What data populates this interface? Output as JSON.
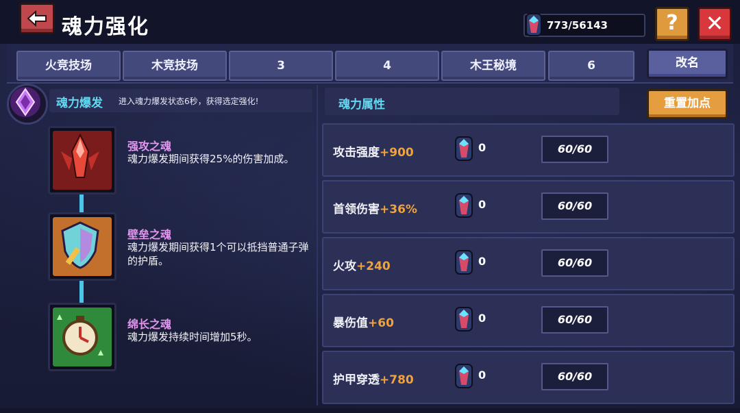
{
  "header": {
    "title": "魂力强化",
    "currency": "773/56143",
    "help_label": "?",
    "close_label": "✕"
  },
  "tabs": [
    {
      "label": "火竞技场"
    },
    {
      "label": "木竞技场"
    },
    {
      "label": "3"
    },
    {
      "label": "4"
    },
    {
      "label": "木王秘境"
    },
    {
      "label": "6"
    }
  ],
  "rename_label": "改名",
  "soul_burst": {
    "title": "魂力爆发",
    "description": "进入魂力爆发状态6秒，获得选定强化!"
  },
  "skills": [
    {
      "name": "强攻之魂",
      "description": "魂力爆发期间获得25%的伤害加成。",
      "icon": "red-bullet-icon"
    },
    {
      "name": "壁垒之魂",
      "description": "魂力爆发期间获得1个可以抵挡普通子弹的护盾。",
      "icon": "shield-icon"
    },
    {
      "name": "绵长之魂",
      "description": "魂力爆发持续时间增加5秒。",
      "icon": "clock-icon"
    }
  ],
  "attributes": {
    "header": "魂力属性",
    "reset_label": "重置加点",
    "rows": [
      {
        "label": "攻击强度",
        "bonus": "+900",
        "points": "0",
        "level": "60/60"
      },
      {
        "label": "首领伤害",
        "bonus": "+36%",
        "points": "0",
        "level": "60/60"
      },
      {
        "label": "火攻",
        "bonus": "+240",
        "points": "0",
        "level": "60/60"
      },
      {
        "label": "暴伤值",
        "bonus": "+60",
        "points": "0",
        "level": "60/60"
      },
      {
        "label": "护甲穿透",
        "bonus": "+780",
        "points": "0",
        "level": "60/60"
      }
    ]
  },
  "colors": {
    "accent_cyan": "#63d8f0",
    "skill_name_pink": "#e495f0",
    "bonus_orange": "#f0a23c",
    "close_red": "#d8383c",
    "help_orange": "#e09a3e"
  }
}
